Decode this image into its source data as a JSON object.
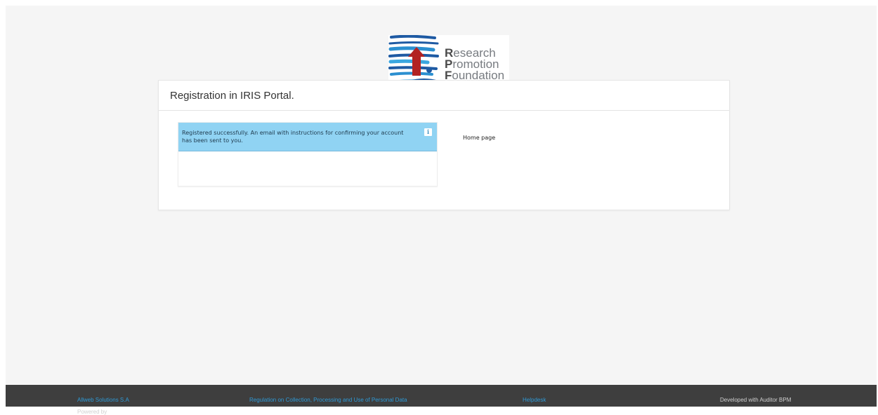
{
  "logo": {
    "line1_cap": "R",
    "line1_rest": "esearch",
    "line2_cap": "P",
    "line2_rest": "romotion",
    "line3_cap": "F",
    "line3_rest": "oundation"
  },
  "card": {
    "title": "Registration in IRIS Portal."
  },
  "alert": {
    "message": "Registered successfully. An email with instructions for confirming your account has been sent to you.",
    "icon": "info-icon",
    "icon_glyph": "i"
  },
  "links": {
    "home_page": "Home page"
  },
  "footer": {
    "powered_by": "Powered by ",
    "powered_by_link": "Allweb Solutions S.A",
    "regulation": "Regulation on Collection, Processing and Use of Personal Data",
    "helpdesk": "Helpdesk",
    "developed_with": "Developed with Auditor BPM"
  },
  "colors": {
    "alert_bg": "#90d3f3",
    "footer_bg": "#3e3e3e",
    "link": "#2f9ad6",
    "logo_arrow": "#b22222",
    "logo_stripes": "#1a5fa8"
  }
}
